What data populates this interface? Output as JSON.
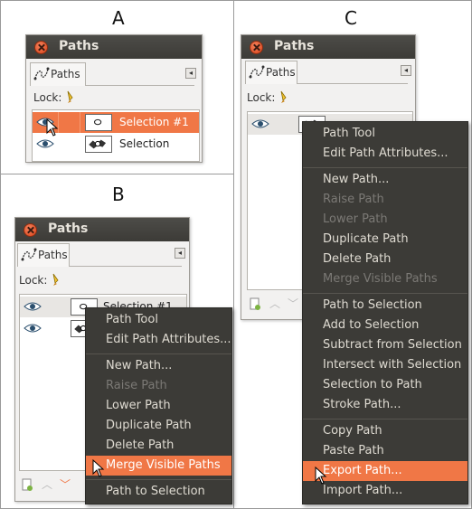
{
  "labels": {
    "a": "A",
    "b": "B",
    "c": "C"
  },
  "panel_title": "Paths",
  "tab_label": "Paths",
  "lock_label": "Lock:",
  "rows": {
    "first": "Selection #1",
    "second": "Selection"
  },
  "menu": {
    "path_tool": "Path Tool",
    "edit_attrs": "Edit Path Attributes...",
    "new_path": "New Path...",
    "raise_path": "Raise Path",
    "lower_path": "Lower Path",
    "duplicate_path": "Duplicate Path",
    "delete_path": "Delete Path",
    "merge_visible": "Merge Visible Paths",
    "path_to_selection": "Path to Selection",
    "add_to_selection": "Add to Selection",
    "subtract_from_selection": "Subtract from Selection",
    "intersect_with_selection": "Intersect with Selection",
    "selection_to_path": "Selection to Path",
    "stroke_path": "Stroke Path...",
    "copy_path": "Copy Path",
    "paste_path": "Paste Path",
    "export_path": "Export Path...",
    "import_path": "Import Path..."
  },
  "colors": {
    "highlight": "#f07746",
    "menu_bg": "#3c3b37",
    "titlebar": "#3c3b37"
  }
}
